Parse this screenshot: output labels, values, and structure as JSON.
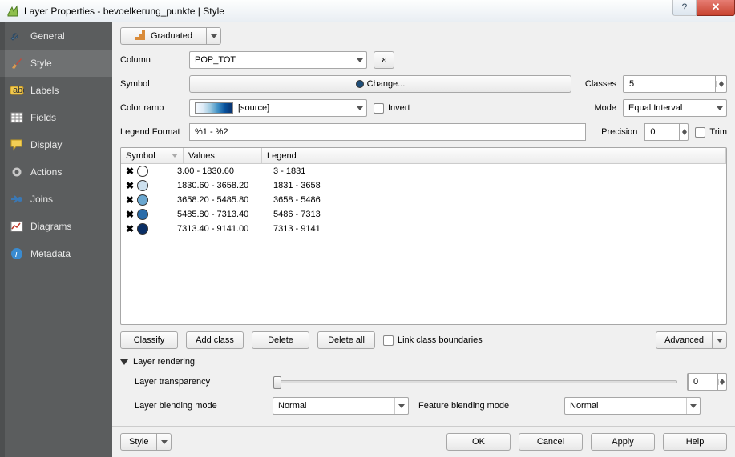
{
  "window": {
    "title": "Layer Properties - bevoelkerung_punkte | Style"
  },
  "sidebar": {
    "items": [
      {
        "label": "General"
      },
      {
        "label": "Style"
      },
      {
        "label": "Labels"
      },
      {
        "label": "Fields"
      },
      {
        "label": "Display"
      },
      {
        "label": "Actions"
      },
      {
        "label": "Joins"
      },
      {
        "label": "Diagrams"
      },
      {
        "label": "Metadata"
      }
    ]
  },
  "renderer": {
    "type": "Graduated"
  },
  "column": {
    "label": "Column",
    "value": "POP_TOT",
    "eps": "ε"
  },
  "symbol": {
    "label": "Symbol",
    "change": "Change..."
  },
  "classes": {
    "label": "Classes",
    "value": "5"
  },
  "colorramp": {
    "label": "Color ramp",
    "value": "[source]",
    "invert": "Invert"
  },
  "mode": {
    "label": "Mode",
    "value": "Equal Interval"
  },
  "legendfmt": {
    "label": "Legend Format",
    "value": "%1 - %2"
  },
  "precision": {
    "label": "Precision",
    "value": "0",
    "trim": "Trim"
  },
  "table": {
    "headers": {
      "symbol": "Symbol",
      "values": "Values",
      "legend": "Legend"
    },
    "rows": [
      {
        "color": "#ffffff",
        "values": "3.00 - 1830.60",
        "legend": "3 - 1831"
      },
      {
        "color": "#cde0ee",
        "values": "1830.60 - 3658.20",
        "legend": "1831 - 3658"
      },
      {
        "color": "#6aa7d0",
        "values": "3658.20 - 5485.80",
        "legend": "3658 - 5486"
      },
      {
        "color": "#2a6ca9",
        "values": "5485.80 - 7313.40",
        "legend": "5486 - 7313"
      },
      {
        "color": "#0a2f66",
        "values": "7313.40 - 9141.00",
        "legend": "7313 - 9141"
      }
    ]
  },
  "buttons": {
    "classify": "Classify",
    "addclass": "Add class",
    "delete": "Delete",
    "deleteall": "Delete all",
    "linkbounds": "Link class boundaries",
    "advanced": "Advanced"
  },
  "rendering": {
    "title": "Layer rendering",
    "transparency": "Layer transparency",
    "transparency_val": "0",
    "layerblend_label": "Layer blending mode",
    "layerblend": "Normal",
    "featureblend_label": "Feature blending mode",
    "featureblend": "Normal"
  },
  "footer": {
    "style": "Style",
    "ok": "OK",
    "cancel": "Cancel",
    "apply": "Apply",
    "help": "Help"
  }
}
